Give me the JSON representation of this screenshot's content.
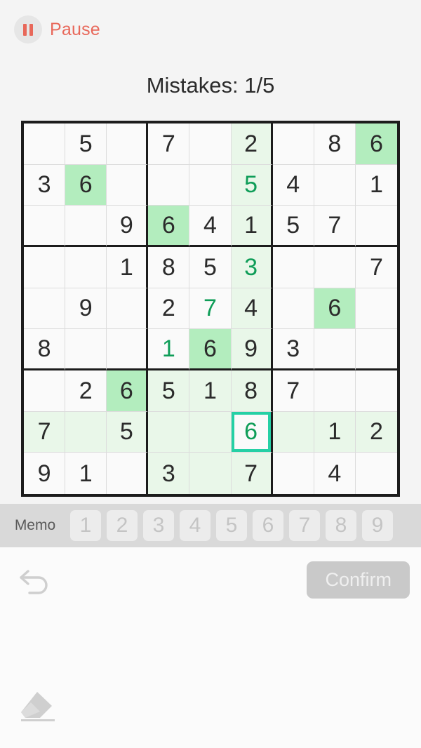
{
  "header": {
    "pause_label": "Pause",
    "pause_icon": "pause-icon",
    "mistakes_text": "Mistakes: 1/5"
  },
  "colors": {
    "accent_pause": "#e8685a",
    "user_number": "#0f9d58",
    "given_number": "#2b2b2b",
    "highlight_soft": "#e9f7e9",
    "highlight_strong": "#b3edbe",
    "selection_ring": "#25d0a5",
    "grid_line": "#1c1c1c",
    "page_bg": "#f4f4f4"
  },
  "board": {
    "size": 9,
    "selected": {
      "row": 8,
      "col": 6,
      "value": "6"
    },
    "rows": [
      [
        {
          "v": "",
          "t": "given"
        },
        {
          "v": "5",
          "t": "given"
        },
        {
          "v": "",
          "t": "given"
        },
        {
          "v": "7",
          "t": "given"
        },
        {
          "v": "",
          "t": "given"
        },
        {
          "v": "2",
          "t": "given",
          "hl": "soft"
        },
        {
          "v": "",
          "t": "given"
        },
        {
          "v": "8",
          "t": "given"
        },
        {
          "v": "6",
          "t": "given",
          "hl": "strong"
        }
      ],
      [
        {
          "v": "3",
          "t": "given"
        },
        {
          "v": "6",
          "t": "given",
          "hl": "strong"
        },
        {
          "v": "",
          "t": "given"
        },
        {
          "v": "",
          "t": "given"
        },
        {
          "v": "",
          "t": "given"
        },
        {
          "v": "5",
          "t": "user",
          "hl": "soft"
        },
        {
          "v": "4",
          "t": "given"
        },
        {
          "v": "",
          "t": "given"
        },
        {
          "v": "1",
          "t": "given"
        }
      ],
      [
        {
          "v": "",
          "t": "given"
        },
        {
          "v": "",
          "t": "given"
        },
        {
          "v": "9",
          "t": "given"
        },
        {
          "v": "6",
          "t": "given",
          "hl": "strong"
        },
        {
          "v": "4",
          "t": "given"
        },
        {
          "v": "1",
          "t": "given",
          "hl": "soft"
        },
        {
          "v": "5",
          "t": "given"
        },
        {
          "v": "7",
          "t": "given"
        },
        {
          "v": "",
          "t": "given"
        }
      ],
      [
        {
          "v": "",
          "t": "given"
        },
        {
          "v": "",
          "t": "given"
        },
        {
          "v": "1",
          "t": "given"
        },
        {
          "v": "8",
          "t": "given"
        },
        {
          "v": "5",
          "t": "given"
        },
        {
          "v": "3",
          "t": "user",
          "hl": "soft"
        },
        {
          "v": "",
          "t": "given"
        },
        {
          "v": "",
          "t": "given"
        },
        {
          "v": "7",
          "t": "given"
        }
      ],
      [
        {
          "v": "",
          "t": "given"
        },
        {
          "v": "9",
          "t": "given"
        },
        {
          "v": "",
          "t": "given"
        },
        {
          "v": "2",
          "t": "given"
        },
        {
          "v": "7",
          "t": "user"
        },
        {
          "v": "4",
          "t": "given",
          "hl": "soft"
        },
        {
          "v": "",
          "t": "given"
        },
        {
          "v": "6",
          "t": "given",
          "hl": "strong"
        },
        {
          "v": "",
          "t": "given"
        }
      ],
      [
        {
          "v": "8",
          "t": "given"
        },
        {
          "v": "",
          "t": "given"
        },
        {
          "v": "",
          "t": "given"
        },
        {
          "v": "1",
          "t": "user"
        },
        {
          "v": "6",
          "t": "given",
          "hl": "strong"
        },
        {
          "v": "9",
          "t": "given",
          "hl": "soft"
        },
        {
          "v": "3",
          "t": "given"
        },
        {
          "v": "",
          "t": "given"
        },
        {
          "v": "",
          "t": "given"
        }
      ],
      [
        {
          "v": "",
          "t": "given"
        },
        {
          "v": "2",
          "t": "given"
        },
        {
          "v": "6",
          "t": "given",
          "hl": "strong"
        },
        {
          "v": "5",
          "t": "given",
          "hl": "soft"
        },
        {
          "v": "1",
          "t": "given",
          "hl": "soft"
        },
        {
          "v": "8",
          "t": "given",
          "hl": "soft"
        },
        {
          "v": "7",
          "t": "given"
        },
        {
          "v": "",
          "t": "given"
        },
        {
          "v": "",
          "t": "given"
        }
      ],
      [
        {
          "v": "7",
          "t": "given",
          "hl": "soft"
        },
        {
          "v": "",
          "t": "given",
          "hl": "soft"
        },
        {
          "v": "5",
          "t": "given",
          "hl": "soft"
        },
        {
          "v": "",
          "t": "given",
          "hl": "soft"
        },
        {
          "v": "",
          "t": "given",
          "hl": "soft"
        },
        {
          "v": "6",
          "t": "user",
          "hl": "selected"
        },
        {
          "v": "",
          "t": "given",
          "hl": "soft"
        },
        {
          "v": "1",
          "t": "given",
          "hl": "soft"
        },
        {
          "v": "2",
          "t": "given",
          "hl": "soft"
        }
      ],
      [
        {
          "v": "9",
          "t": "given"
        },
        {
          "v": "1",
          "t": "given"
        },
        {
          "v": "",
          "t": "given"
        },
        {
          "v": "3",
          "t": "given",
          "hl": "soft"
        },
        {
          "v": "",
          "t": "given",
          "hl": "soft"
        },
        {
          "v": "7",
          "t": "given",
          "hl": "soft"
        },
        {
          "v": "",
          "t": "given"
        },
        {
          "v": "4",
          "t": "given"
        },
        {
          "v": "",
          "t": "given"
        }
      ]
    ]
  },
  "numbar": {
    "memo_label": "Memo",
    "keys": [
      "1",
      "2",
      "3",
      "4",
      "5",
      "6",
      "7",
      "8",
      "9"
    ],
    "disabled": true
  },
  "actions": {
    "undo_icon": "undo-icon",
    "confirm_label": "Confirm",
    "confirm_disabled": true,
    "eraser_icon": "eraser-icon"
  }
}
